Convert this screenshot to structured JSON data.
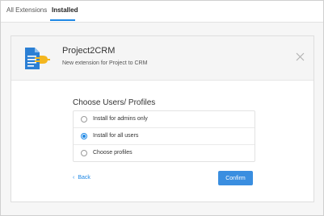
{
  "tabs": [
    {
      "label": "All Extensions",
      "active": false
    },
    {
      "label": "Installed",
      "active": true
    }
  ],
  "extension": {
    "name": "Project2CRM",
    "description": "New extension for Project to CRM",
    "icon": "document-plug-icon"
  },
  "dialog": {
    "section_title": "Choose Users/ Profiles",
    "options": [
      {
        "label": "Install for admins only",
        "selected": false
      },
      {
        "label": "Install for all users",
        "selected": true
      },
      {
        "label": "Choose profiles",
        "selected": false
      }
    ],
    "back_label": "Back",
    "confirm_label": "Confirm"
  },
  "colors": {
    "accent": "#1e88e5",
    "icon_doc": "#2b7fd4",
    "icon_plug": "#f3b61f"
  }
}
